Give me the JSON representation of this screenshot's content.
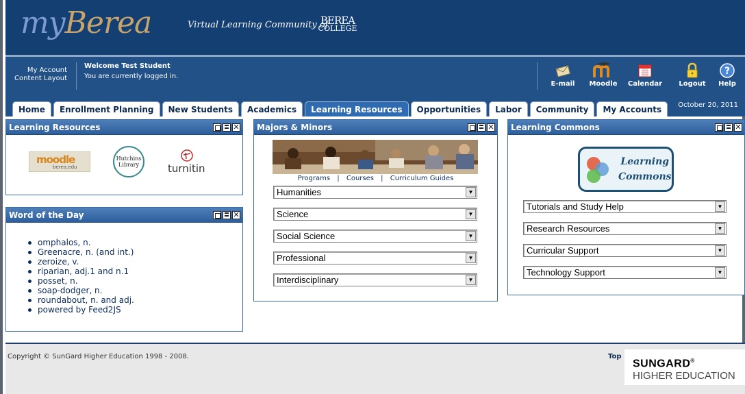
{
  "banner": {
    "logo_my": "my",
    "logo_berea": "Berea",
    "tagline": "Virtual Learning Community of",
    "college_line1": "BEREA",
    "college_line2": "COLLEGE"
  },
  "account": {
    "my_account": "My Account",
    "content_layout": "Content Layout",
    "welcome": "Welcome Test Student",
    "status": "You are currently logged in."
  },
  "tools": [
    {
      "label": "E-mail",
      "icon": "email-icon"
    },
    {
      "label": "Moodle",
      "icon": "moodle-icon"
    },
    {
      "label": "Calendar",
      "icon": "calendar-icon"
    },
    {
      "label": "Logout",
      "icon": "lock-icon"
    },
    {
      "label": "Help",
      "icon": "help-icon"
    }
  ],
  "date": "October 20, 2011",
  "tabs": [
    {
      "label": "Home"
    },
    {
      "label": "Enrollment Planning"
    },
    {
      "label": "New Students"
    },
    {
      "label": "Academics"
    },
    {
      "label": "Learning Resources",
      "active": true
    },
    {
      "label": "Opportunities"
    },
    {
      "label": "Labor"
    },
    {
      "label": "Community"
    },
    {
      "label": "My Accounts"
    }
  ],
  "learning_resources": {
    "title": "Learning Resources",
    "moodle_logo": "moodle",
    "moodle_sub": "berea.edu",
    "hutchins_line1": "Hutchins",
    "hutchins_line2": "Library",
    "turnitin": "turnitin"
  },
  "word_of_day": {
    "title": "Word of the Day",
    "items": [
      "omphalos, n.",
      "Greenacre, n. (and int.)",
      "zeroize, v.",
      "riparian, adj.1 and n.1",
      "posset, n.",
      "soap-dodger, n.",
      "roundabout, n. and adj.",
      "powered by Feed2JS"
    ]
  },
  "majors": {
    "title": "Majors & Minors",
    "links": [
      "Programs",
      "Courses",
      "Curriculum Guides"
    ],
    "selects": [
      "Humanities",
      "Science",
      "Social Science",
      "Professional",
      "Interdisciplinary"
    ]
  },
  "commons": {
    "title": "Learning Commons",
    "logo_line1": "Learning",
    "logo_line2": "Commons",
    "selects": [
      "Tutorials and Study Help",
      "Research Resources",
      "Curricular Support",
      "Technology Support"
    ]
  },
  "footer": {
    "copyright": "Copyright © SunGard Higher Education 1998 - 2008.",
    "top": "Top",
    "sungard_line1": "SUNGARD",
    "sungard_reg": "®",
    "sungard_line2": "HIGHER EDUCATION"
  }
}
